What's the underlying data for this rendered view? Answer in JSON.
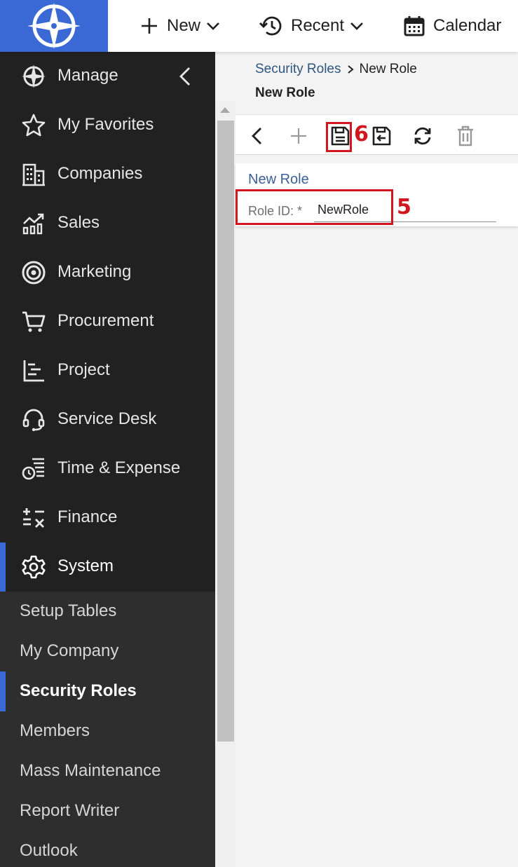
{
  "topbar": {
    "new_label": "New",
    "recent_label": "Recent",
    "calendar_label": "Calendar"
  },
  "sidebar": {
    "items": [
      {
        "label": "Manage",
        "icon": "compass-icon"
      },
      {
        "label": "My Favorites",
        "icon": "star-icon"
      },
      {
        "label": "Companies",
        "icon": "building-icon"
      },
      {
        "label": "Sales",
        "icon": "chart-up-icon"
      },
      {
        "label": "Marketing",
        "icon": "target-icon"
      },
      {
        "label": "Procurement",
        "icon": "cart-icon"
      },
      {
        "label": "Project",
        "icon": "gantt-icon"
      },
      {
        "label": "Service Desk",
        "icon": "headset-icon"
      },
      {
        "label": "Time & Expense",
        "icon": "clock-list-icon"
      },
      {
        "label": "Finance",
        "icon": "calc-icon"
      },
      {
        "label": "System",
        "icon": "gear-icon",
        "active": true
      }
    ],
    "subitems": [
      {
        "label": "Setup Tables"
      },
      {
        "label": "My Company"
      },
      {
        "label": "Security Roles",
        "active": true
      },
      {
        "label": "Members"
      },
      {
        "label": "Mass Maintenance"
      },
      {
        "label": "Report Writer"
      },
      {
        "label": "Outlook"
      }
    ]
  },
  "breadcrumb": {
    "parent": "Security Roles",
    "current": "New Role"
  },
  "page": {
    "title": "New Role"
  },
  "form": {
    "title": "New Role",
    "role_id_label": "Role ID: *",
    "role_id_value": "NewRole"
  },
  "annotations": {
    "save_step": "6",
    "field_step": "5"
  },
  "colors": {
    "brand": "#3a69d6",
    "annotation": "#d1161d",
    "sidebar_bg": "#212121"
  }
}
